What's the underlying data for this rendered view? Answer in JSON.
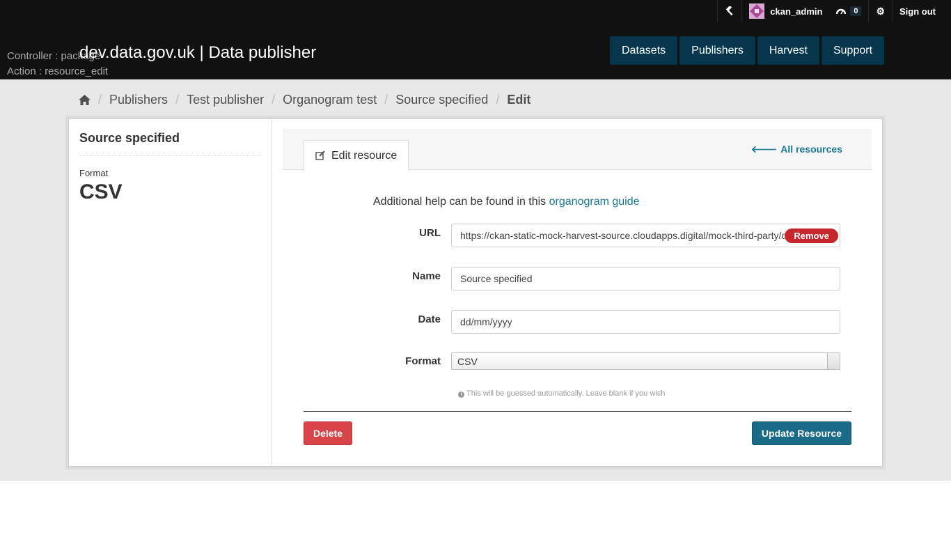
{
  "account": {
    "admin_icon": "hammer-icon",
    "username": "ckan_admin",
    "dashboard_icon": "dashboard-icon",
    "activity_count": "0",
    "settings_icon": "gear-icon",
    "sign_out": "Sign out"
  },
  "debug": {
    "controller": "Controller : package",
    "action": "Action : resource_edit"
  },
  "header": {
    "site_title": "dev.data.gov.uk | Data publisher"
  },
  "nav": {
    "items": [
      {
        "label": "Datasets"
      },
      {
        "label": "Publishers"
      },
      {
        "label": "Harvest"
      },
      {
        "label": "Support"
      }
    ]
  },
  "breadcrumb": {
    "home_icon": "home-icon",
    "items": [
      {
        "label": "Publishers"
      },
      {
        "label": "Test publisher"
      },
      {
        "label": "Organogram test"
      },
      {
        "label": "Source specified"
      },
      {
        "label": "Edit"
      }
    ]
  },
  "sidebar": {
    "heading": "Source specified",
    "format_label": "Format",
    "format_value": "CSV"
  },
  "page": {
    "tab_label": "Edit resource",
    "all_resources": "All resources"
  },
  "form": {
    "help_prefix": "Additional help can be found in this",
    "help_link": "organogram guide",
    "url_label": "URL",
    "url_value": "https://ckan-static-mock-harvest-source.cloudapps.digital/mock-third-party/organogram.csv",
    "remove_label": "Remove",
    "name_label": "Name",
    "name_value": "Source specified",
    "date_label": "Date",
    "date_placeholder": "dd/mm/yyyy",
    "format_label": "Format",
    "format_value": "CSV",
    "format_help": "This will be guessed automatically. Leave blank if you wish",
    "delete_label": "Delete",
    "update_label": "Update Resource"
  },
  "colors": {
    "header_bg": "#111111",
    "nav_bg": "#05364c",
    "link": "#187794",
    "danger": "#d9434a",
    "primary_button": "#1a6b87"
  }
}
